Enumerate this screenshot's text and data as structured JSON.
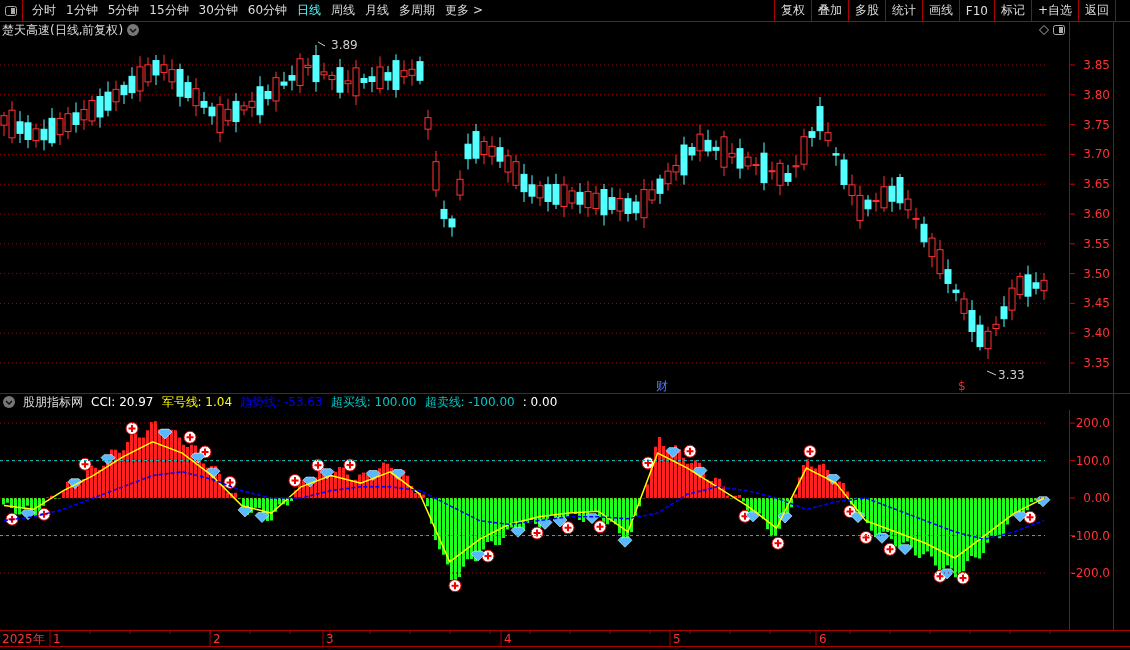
{
  "toolbar": {
    "periods": [
      {
        "label": "分时",
        "selected": false
      },
      {
        "label": "1分钟",
        "selected": false
      },
      {
        "label": "5分钟",
        "selected": false
      },
      {
        "label": "15分钟",
        "selected": false
      },
      {
        "label": "30分钟",
        "selected": false
      },
      {
        "label": "60分钟",
        "selected": false
      },
      {
        "label": "日线",
        "selected": true
      },
      {
        "label": "周线",
        "selected": false
      },
      {
        "label": "月线",
        "selected": false
      },
      {
        "label": "多周期",
        "selected": false
      },
      {
        "label": "更多 >",
        "selected": false
      }
    ],
    "buttons": [
      "复权",
      "叠加",
      "多股",
      "统计",
      "画线",
      "F10",
      "标记",
      "+自选",
      "返回"
    ]
  },
  "price_chart": {
    "title": "楚天高速(日线,前复权)",
    "high_label": "3.89",
    "low_label": "3.33",
    "finance_marker": "财",
    "dollar_marker": "$",
    "axis_labels": [
      "3.85",
      "3.80",
      "3.75",
      "3.70",
      "3.65",
      "3.60",
      "3.55",
      "3.50",
      "3.45",
      "3.40",
      "3.35"
    ]
  },
  "indicator": {
    "name": "股朋指标网",
    "legend": [
      {
        "label": "CCI: 20.97",
        "color": "#ffffff"
      },
      {
        "label": "军号线: 1.04",
        "color": "#ffff00"
      },
      {
        "label": "趋势线: -53.63",
        "color": "#0000ff"
      },
      {
        "label": "超买线: 100.00",
        "color": "#00c8c8"
      },
      {
        "label": "超卖线: -100.00",
        "color": "#00c8c8"
      },
      {
        "label": ": 0.00",
        "color": "#ffffff"
      }
    ],
    "chart_data": {
      "type": "line",
      "grid": true,
      "ylim": [
        -352,
        235
      ],
      "yticks": [
        {
          "value": 200,
          "label": "200.0"
        },
        {
          "value": 100,
          "label": "100.0"
        },
        {
          "value": 0,
          "label": "0.00"
        },
        {
          "value": -100,
          "label": "-100.0"
        },
        {
          "value": -200,
          "label": "-200.0"
        }
      ],
      "series": [
        {
          "color": "#ffff00",
          "line_style": "solid",
          "values": [
            -20,
            -30,
            20,
            60,
            110,
            150,
            120,
            60,
            -20,
            -40,
            30,
            60,
            40,
            70,
            10,
            -170,
            -110,
            -70,
            -50,
            -40,
            -35,
            -90,
            120,
            80,
            30,
            -20,
            -80,
            80,
            40,
            -60,
            -90,
            -120,
            -160,
            -100,
            -40,
            0
          ]
        },
        {
          "color": "#0000ff",
          "line_style": "dashed",
          "values": [
            -60,
            -50,
            -30,
            0,
            30,
            60,
            70,
            50,
            20,
            0,
            0,
            20,
            30,
            30,
            20,
            -20,
            -60,
            -70,
            -60,
            -50,
            -50,
            -55,
            -40,
            10,
            30,
            20,
            0,
            -30,
            -10,
            0,
            -30,
            -60,
            -90,
            -110,
            -90,
            -60
          ]
        }
      ]
    }
  },
  "date_axis": [
    "2025年",
    "1",
    "2",
    "3",
    "4",
    "5",
    "6"
  ]
}
